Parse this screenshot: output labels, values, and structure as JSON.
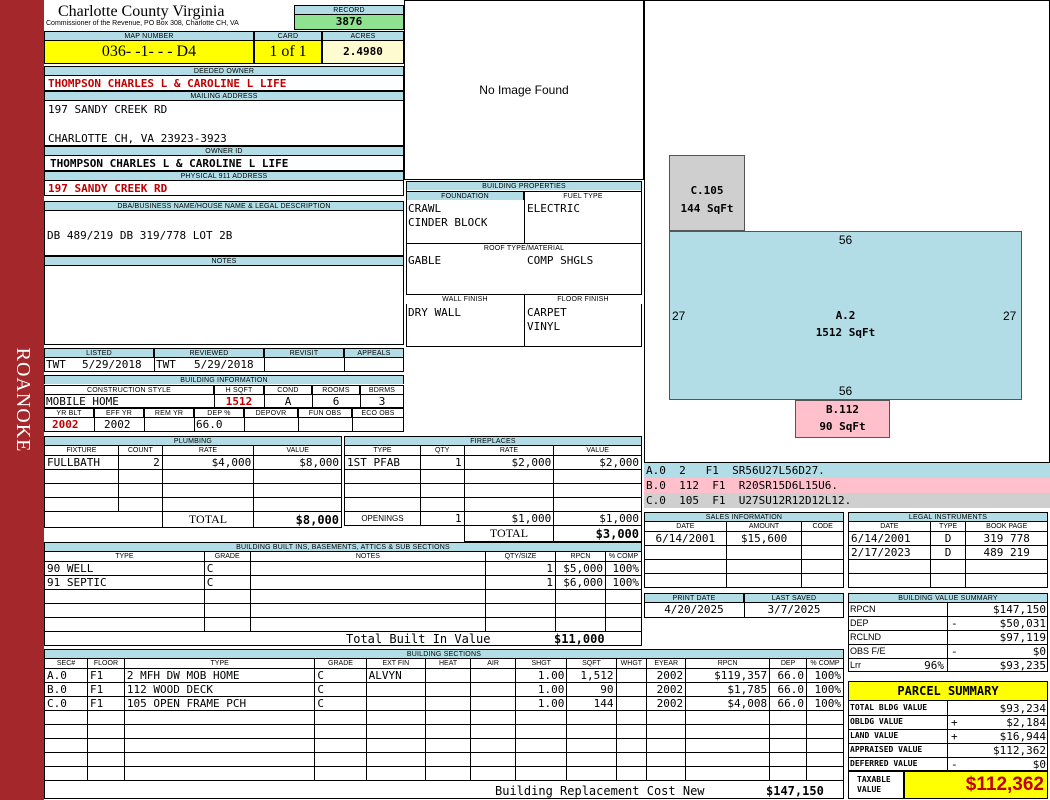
{
  "sidebar": {
    "label": "ROANOKE"
  },
  "county": {
    "name": "Charlotte County Virginia",
    "address": "Commissioner of the Revenue, PO Box 308, Charlotte CH, VA"
  },
  "record": {
    "label": "RECORD",
    "value": "3876"
  },
  "map": {
    "label": "MAP NUMBER",
    "value": "036- -1- - - D4"
  },
  "card": {
    "label": "CARD",
    "value": "1 of 1"
  },
  "acres": {
    "label": "ACRES",
    "value": "2.4980"
  },
  "owner": {
    "label": "DEEDED OWNER",
    "value": "THOMPSON CHARLES L & CAROLINE L LIFE"
  },
  "mailing": {
    "label": "MAILING ADDRESS",
    "line1": "197 SANDY CREEK RD",
    "line2": "CHARLOTTE CH, VA 23923-3923"
  },
  "owner_id": {
    "label": "OWNER ID",
    "value": "THOMPSON CHARLES L & CAROLINE L LIFE"
  },
  "physical": {
    "label": "PHYSICAL 911 ADDRESS",
    "value": "197 SANDY CREEK RD"
  },
  "legal": {
    "label": "DBA/BUSINESS NAME/HOUSE NAME & LEGAL DESCRIPTION",
    "value": "DB 489/219 DB 319/778 LOT 2B"
  },
  "notes": {
    "label": "NOTES"
  },
  "photo": {
    "text": "No Image Found"
  },
  "listed": {
    "listed_label": "LISTED",
    "reviewed_label": "REVIEWED",
    "revisit_label": "REVISIT",
    "appeals_label": "APPEALS",
    "listed_by": "TWT",
    "listed_date": "5/29/2018",
    "reviewed_by": "TWT",
    "reviewed_date": "5/29/2018"
  },
  "building_info": {
    "label": "BUILDING INFORMATION",
    "style_label": "CONSTRUCTION STYLE",
    "hsqft_label": "H SQFT",
    "cond_label": "COND",
    "rooms_label": "ROOMS",
    "bdrms_label": "BDRMS",
    "style": "MOBILE HOME",
    "hsqft": "1512",
    "cond": "A",
    "rooms": "6",
    "bdrms": "3",
    "yrblt_label": "YR BLT",
    "effyr_label": "EFF YR",
    "remyr_label": "REM YR",
    "dep_label": "DEP %",
    "depovr_label": "DEPOVR",
    "funobs_label": "FUN OBS",
    "ecoobs_label": "ECO OBS",
    "yrblt": "2002",
    "effyr": "2002",
    "dep": "66.0"
  },
  "building_props": {
    "label": "BUILDING PROPERTIES",
    "foundation_label": "FOUNDATION",
    "fuel_label": "FUEL TYPE",
    "foundation1": "CRAWL",
    "foundation2": "CINDER BLOCK",
    "fuel": "ELECTRIC",
    "roof_label": "ROOF TYPE/MATERIAL",
    "roof1": "GABLE",
    "roof2": "COMP SHGLS",
    "wall_label": "WALL FINISH",
    "floor_label": "FLOOR FINISH",
    "wall": "DRY WALL",
    "floor1": "CARPET",
    "floor2": "VINYL"
  },
  "sketch": {
    "c_label": "C.105",
    "c_area": "144 SqFt",
    "a_label": "A.2",
    "a_area": "1512 SqFt",
    "a_top": "56",
    "a_bottom": "56",
    "a_left": "27",
    "a_right": "27",
    "b_label": "B.112",
    "b_area": "90 SqFt"
  },
  "sketch_codes": [
    {
      "text": "A.0  2   F1  SR56U27L56D27.",
      "color": "#b3dde6"
    },
    {
      "text": "B.0  112  F1  R20SR15D6L15U6.",
      "color": "#ffc0cb"
    },
    {
      "text": "C.0  105  F1  U27SU12R12D12L12.",
      "color": "#cfcfcf"
    }
  ],
  "plumbing": {
    "label": "PLUMBING",
    "headers": [
      "FIXTURE",
      "COUNT",
      "RATE",
      "VALUE"
    ],
    "rows": [
      [
        "FULLBATH",
        "2",
        "$4,000",
        "$8,000"
      ]
    ],
    "total_label": "TOTAL",
    "total": "$8,000"
  },
  "fireplaces": {
    "label": "FIREPLACES",
    "headers": [
      "TYPE",
      "QTY",
      "RATE",
      "VALUE"
    ],
    "rows": [
      [
        "1ST PFAB",
        "1",
        "$2,000",
        "$2,000"
      ]
    ],
    "openings_label": "OPENINGS",
    "openings_qty": "1",
    "openings_rate": "$1,000",
    "openings_value": "$1,000",
    "total_label": "TOTAL",
    "total": "$3,000"
  },
  "sales": {
    "label": "SALES INFORMATION",
    "headers": [
      "DATE",
      "AMOUNT",
      "CODE"
    ],
    "rows": [
      [
        "6/14/2001",
        "$15,600",
        ""
      ]
    ]
  },
  "legal_instruments": {
    "label": "LEGAL INSTRUMENTS",
    "headers": [
      "DATE",
      "TYPE",
      "BOOK PAGE"
    ],
    "rows": [
      [
        "6/14/2001",
        "D",
        "319 778"
      ],
      [
        "2/17/2023",
        "D",
        "489 219"
      ]
    ]
  },
  "builtins": {
    "label": "BUILDING BUILT INS, BASEMENTS, ATTICS & SUB SECTIONS",
    "headers": [
      "TYPE",
      "GRADE",
      "NOTES",
      "QTY/SIZE",
      "RPCN",
      "% COMP"
    ],
    "rows": [
      [
        "90 WELL",
        "C",
        "",
        "1",
        "$5,000",
        "100%"
      ],
      [
        "91 SEPTIC",
        "C",
        "",
        "1",
        "$6,000",
        "100%"
      ]
    ],
    "total_label": "Total Built In Value",
    "total": "$11,000"
  },
  "print": {
    "print_label": "PRINT DATE",
    "saved_label": "LAST SAVED",
    "print_date": "4/20/2025",
    "saved_date": "3/7/2025"
  },
  "value_summary": {
    "label": "BUILDING VALUE SUMMARY",
    "rows": [
      [
        "RPCN",
        "",
        "",
        "$147,150"
      ],
      [
        "DEP",
        "",
        "-",
        "$50,031"
      ],
      [
        "RCLND",
        "",
        "",
        "$97,119"
      ],
      [
        "OBS F/E",
        "",
        "-",
        "$0"
      ],
      [
        "Lrr",
        "96%",
        "",
        "$93,235"
      ]
    ]
  },
  "sections": {
    "label": "BUILDING SECTIONS",
    "headers": [
      "SEC#",
      "FLOOR",
      "TYPE",
      "GRADE",
      "EXT FIN",
      "HEAT",
      "AIR",
      "SHGT",
      "SQFT",
      "WHGT",
      "EYEAR",
      "RPCN",
      "DEP",
      "% COMP"
    ],
    "rows": [
      [
        "A.0",
        "F1",
        "2 MFH DW MOB HOME",
        "C",
        "ALVYN",
        "",
        "",
        "1.00",
        "1,512",
        "",
        "2002",
        "$119,357",
        "66.0",
        "100%"
      ],
      [
        "B.0",
        "F1",
        "112 WOOD DECK",
        "C",
        "",
        "",
        "",
        "1.00",
        "90",
        "",
        "2002",
        "$1,785",
        "66.0",
        "100%"
      ],
      [
        "C.0",
        "F1",
        "105 OPEN FRAME PCH",
        "C",
        "",
        "",
        "",
        "1.00",
        "144",
        "",
        "2002",
        "$4,008",
        "66.0",
        "100%"
      ]
    ],
    "total_label": "Building Replacement Cost New",
    "total": "$147,150"
  },
  "parcel": {
    "title": "PARCEL SUMMARY",
    "rows": [
      [
        "TOTAL BLDG VALUE",
        "",
        "$93,234"
      ],
      [
        "OBLDG VALUE",
        "+",
        "$2,184"
      ],
      [
        "LAND VALUE",
        "+",
        "$16,944"
      ],
      [
        "APPRAISED VALUE",
        "",
        "$112,362"
      ],
      [
        "DEFERRED VALUE",
        "-",
        "$0"
      ]
    ],
    "taxable_label": "TAXABLE VALUE",
    "taxable": "$112,362"
  }
}
